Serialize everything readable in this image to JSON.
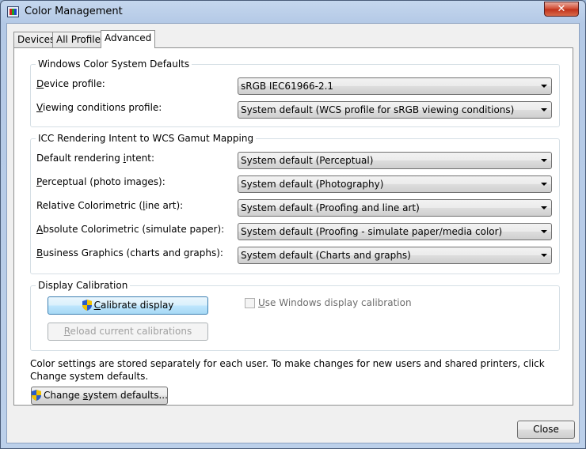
{
  "window": {
    "title": "Color Management",
    "close_glyph": "✕"
  },
  "tabs": [
    {
      "label": "Devices"
    },
    {
      "label": "All Profiles"
    },
    {
      "label": "Advanced"
    }
  ],
  "wcs_defaults": {
    "title": "Windows Color System Defaults",
    "device_profile": {
      "label_ul": "D",
      "label_rest": "evice profile:",
      "value": "sRGB IEC61966-2.1"
    },
    "viewing_conditions": {
      "label_ul": "V",
      "label_rest": "iewing conditions profile:",
      "value": "System default (WCS profile for sRGB viewing conditions)"
    }
  },
  "icc_mapping": {
    "title": "ICC Rendering Intent to WCS Gamut Mapping",
    "rows": [
      {
        "label_pre": "Default rendering ",
        "label_ul": "i",
        "label_post": "ntent:",
        "value": "System default (Perceptual)"
      },
      {
        "label_pre": "",
        "label_ul": "P",
        "label_post": "erceptual (photo images):",
        "value": "System default (Photography)"
      },
      {
        "label_pre": "Relative Colorimetric (",
        "label_ul": "l",
        "label_post": "ine art):",
        "value": "System default (Proofing and line art)"
      },
      {
        "label_pre": "",
        "label_ul": "A",
        "label_post": "bsolute Colorimetric (simulate paper):",
        "value": "System default (Proofing - simulate paper/media color)"
      },
      {
        "label_pre": "",
        "label_ul": "B",
        "label_post": "usiness Graphics (charts and graphs):",
        "value": "System default (Charts and graphs)"
      }
    ]
  },
  "calibration": {
    "title": "Display Calibration",
    "calibrate_button": {
      "ul": "C",
      "rest": "alibrate display"
    },
    "reload_button": {
      "ul": "R",
      "rest": "eload current calibrations"
    },
    "use_windows_calibration": {
      "ul": "U",
      "rest": "se Windows display calibration",
      "checked": false,
      "enabled": false
    }
  },
  "footer": {
    "info_text": "Color settings are stored separately for each user. To make changes for new users and shared printers, click Change system defaults.",
    "change_defaults_button": {
      "pre": "Change ",
      "ul": "s",
      "post": "ystem defaults..."
    },
    "close_button": "Close"
  },
  "colors": {
    "focus_button_border": "#3c7fb1",
    "disabled_text": "#a0a0a0",
    "group_border": "#d5dfe5"
  }
}
